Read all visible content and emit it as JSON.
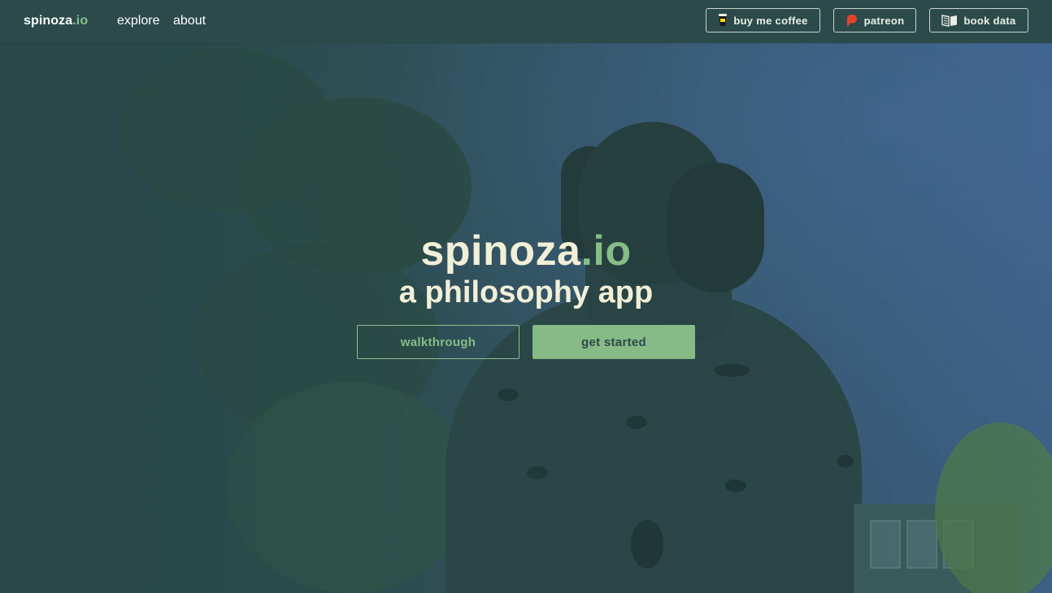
{
  "nav": {
    "brand_name": "spinoza",
    "brand_tld": ".io",
    "links": [
      {
        "label": "explore"
      },
      {
        "label": "about"
      }
    ],
    "buttons": [
      {
        "label": "buy me coffee",
        "icon": "coffee-cup-icon"
      },
      {
        "label": "patreon",
        "icon": "patreon-icon"
      },
      {
        "label": "book data",
        "icon": "open-book-icon"
      }
    ]
  },
  "hero": {
    "title_name": "spinoza",
    "title_tld": ".io",
    "subtitle": "a philosophy app",
    "walkthrough_label": "walkthrough",
    "get_started_label": "get started",
    "background": "spinoza-statue-photo"
  },
  "colors": {
    "nav_bg": "#2c4a4a",
    "accent_green": "#86be86",
    "cream_text": "#f2efd8",
    "patreon_red": "#e0452b"
  }
}
